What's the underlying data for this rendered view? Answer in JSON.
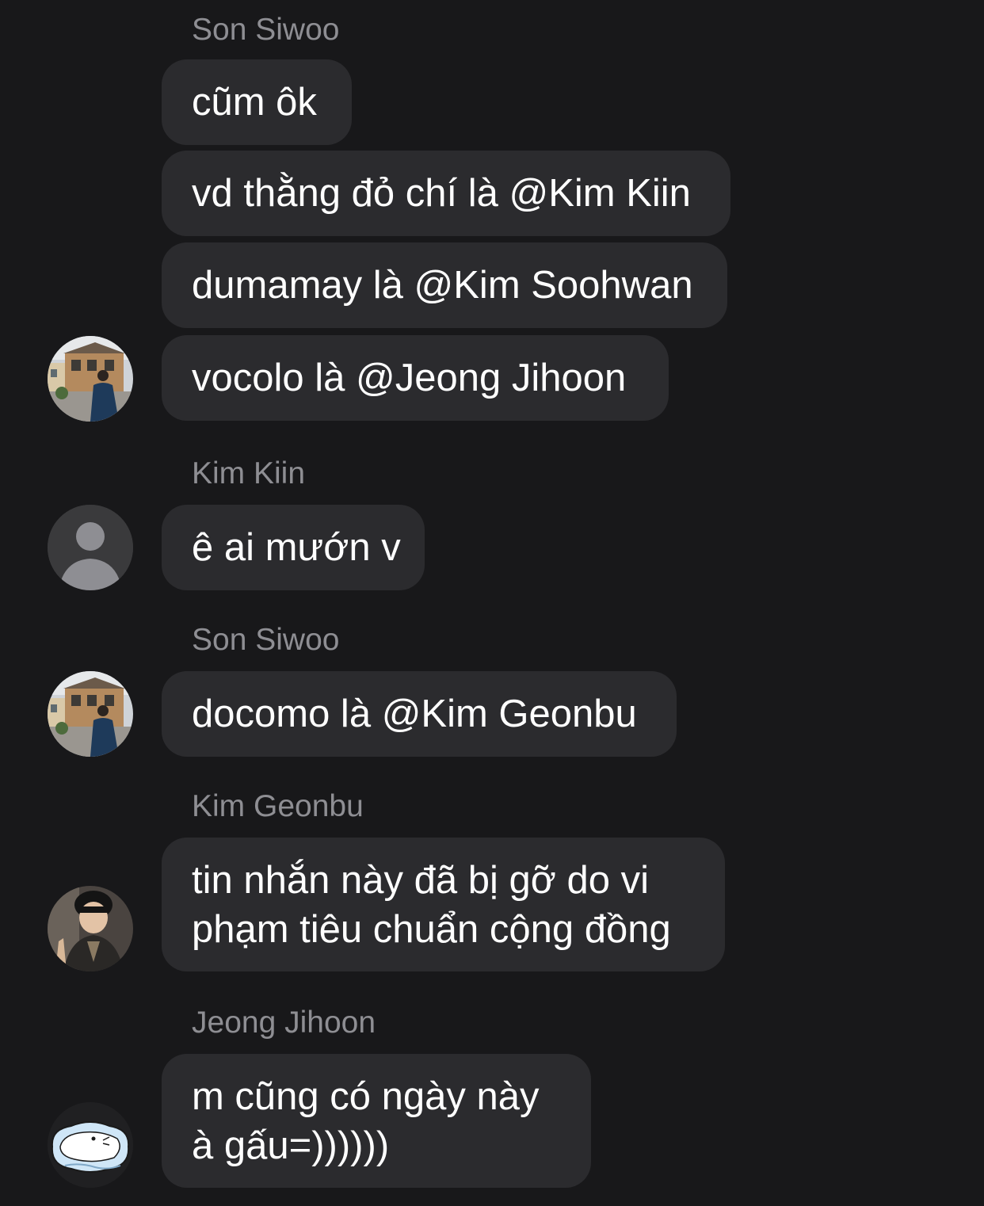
{
  "messages": [
    {
      "sender": "Son Siwoo"
    },
    {
      "text": "cũm ôk"
    },
    {
      "text": "vd thằng đỏ chí là @Kim Kiin"
    },
    {
      "text": "dumamay là @Kim Soohwan"
    },
    {
      "text": "vocolo là @Jeong Jihoon",
      "avatar": "street-photo-avatar"
    },
    {
      "sender": "Kim Kiin"
    },
    {
      "text": "ê ai mướn v",
      "avatar": "default-person-avatar"
    },
    {
      "sender": "Son Siwoo"
    },
    {
      "text": "docomo là @Kim Geonbu",
      "avatar": "street-photo-avatar"
    },
    {
      "sender": "Kim Geonbu"
    },
    {
      "text": "tin nhắn này đã bị gỡ do vi phạm tiêu chuẩn cộng đồng",
      "avatar": "person-photo-avatar"
    },
    {
      "sender": "Jeong Jihoon"
    },
    {
      "text": "m cũng có ngày này à gấu=))))))",
      "avatar": "cartoon-bear-avatar"
    }
  ],
  "colors": {
    "background": "#18181a",
    "bubble": "#2b2b2e",
    "sender_name": "#8e8e93",
    "message_text": "#ffffff"
  }
}
